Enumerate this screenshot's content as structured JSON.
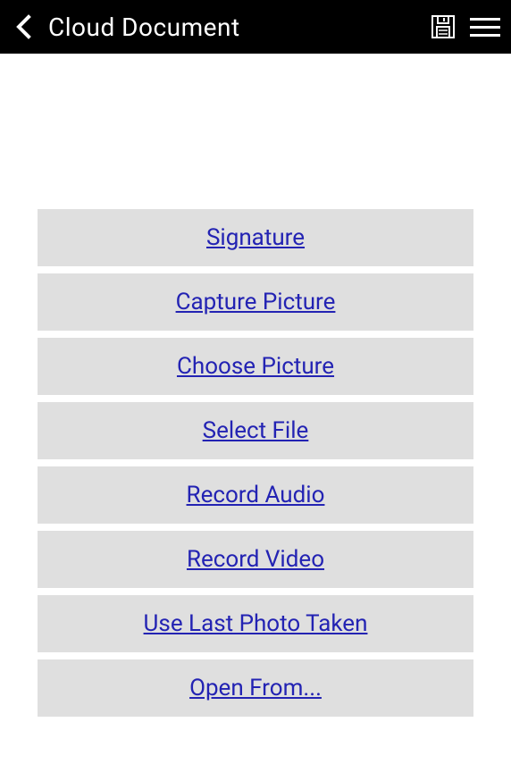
{
  "header": {
    "title": "Cloud Document"
  },
  "actions": {
    "signature": "Signature",
    "capture_picture": "Capture Picture",
    "choose_picture": "Choose Picture",
    "select_file": "Select File",
    "record_audio": "Record Audio",
    "record_video": "Record Video",
    "use_last_photo": "Use Last Photo Taken",
    "open_from": "Open From..."
  }
}
